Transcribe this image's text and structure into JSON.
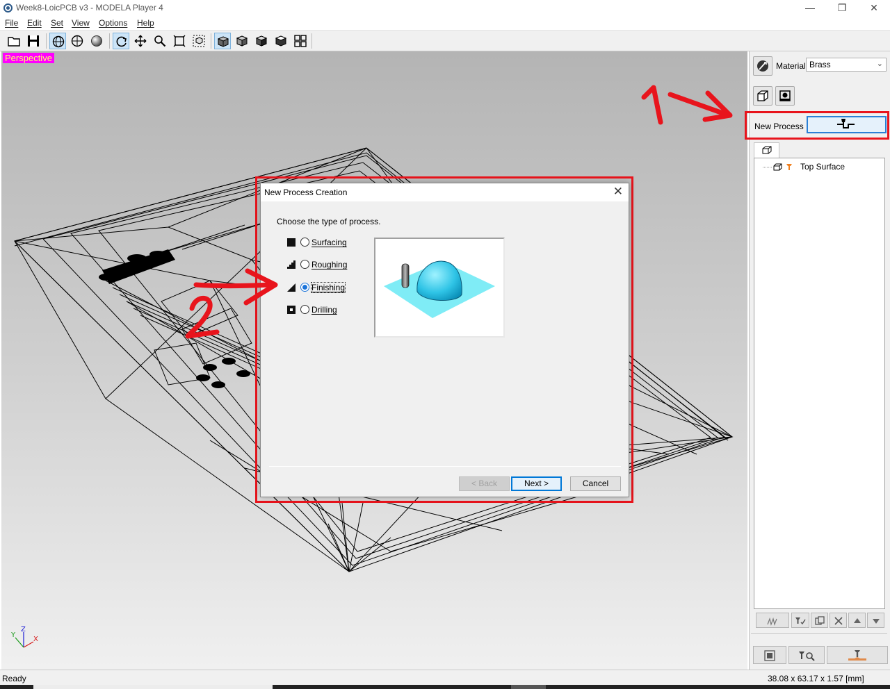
{
  "window": {
    "title": "Week8-LoicPCB v3 - MODELA Player 4"
  },
  "menu": [
    "File",
    "Edit",
    "Set",
    "View",
    "Options",
    "Help"
  ],
  "viewport": {
    "view_label": "Perspective",
    "axes": {
      "x": "X",
      "y": "Y",
      "z": "Z"
    }
  },
  "right_panel": {
    "material_label": "Material",
    "material_value": "Brass",
    "new_process_label": "New Process",
    "tree": [
      {
        "label": "Top Surface"
      }
    ]
  },
  "dialog": {
    "title": "New Process Creation",
    "prompt": "Choose the type of process.",
    "options": [
      {
        "label": "Surfacing",
        "selected": false
      },
      {
        "label": "Roughing",
        "selected": false
      },
      {
        "label": "Finishing",
        "selected": true
      },
      {
        "label": "Drilling",
        "selected": false
      }
    ],
    "buttons": {
      "back": "< Back",
      "next": "Next >",
      "cancel": "Cancel"
    }
  },
  "status": {
    "text": "Ready",
    "dimensions": "38.08 x 63.17 x 1.57 [mm]"
  },
  "colors": {
    "annotation": "#e8141c",
    "perspective_bg": "#ff00ff",
    "perspective_text": "#ffff66",
    "accent": "#0078d7"
  }
}
